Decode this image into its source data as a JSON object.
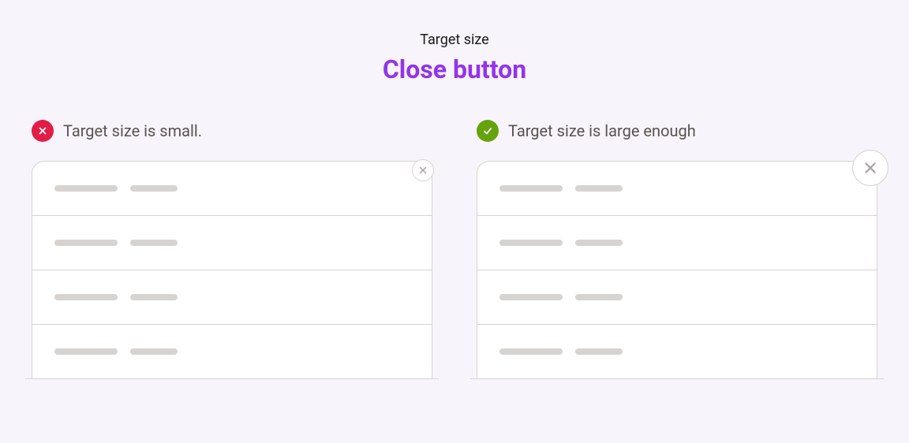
{
  "header": {
    "overline": "Target size",
    "title": "Close button"
  },
  "examples": {
    "bad": {
      "label": "Target size is small."
    },
    "good": {
      "label": "Target size is large enough"
    }
  }
}
